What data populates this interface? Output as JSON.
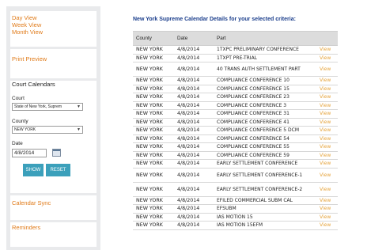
{
  "sidebar": {
    "views": [
      "Day View",
      "Week View",
      "Month View"
    ],
    "print_preview": "Print Preview",
    "court_calendars": {
      "title": "Court Calendars",
      "court_label": "Court",
      "court_value": "State of New York, Suprem",
      "county_label": "County",
      "county_value": "NEW YORK",
      "date_label": "Date",
      "date_value": "4/8/2014",
      "show_label": "SHOW",
      "reset_label": "RESET"
    },
    "calendar_sync": "Calendar Sync",
    "reminders": "Reminders"
  },
  "main": {
    "title": "New York Supreme Calendar Details for your selected criteria:",
    "columns": [
      "County",
      "Date",
      "Part",
      ""
    ],
    "rows": [
      {
        "county": "NEW YORK",
        "date": "4/8/2014",
        "part": "1TXPC PRELIMINARY CONFERENCE",
        "link": "View"
      },
      {
        "county": "NEW YORK",
        "date": "4/8/2014",
        "part": "1TXPT PRE-TRIAL",
        "link": "View"
      },
      {
        "county": "NEW YORK",
        "date": "4/8/2014",
        "part": "40 TRANS AUTH SETTLEMENT PART",
        "link": "View"
      },
      {
        "county": "NEW YORK",
        "date": "4/8/2014",
        "part": "COMPLIANCE CONFERENCE 10",
        "link": "View"
      },
      {
        "county": "NEW YORK",
        "date": "4/8/2014",
        "part": "COMPLIANCE CONFERENCE 15",
        "link": "View"
      },
      {
        "county": "NEW YORK",
        "date": "4/8/2014",
        "part": "COMPLIANCE CONFERENCE 23",
        "link": "View"
      },
      {
        "county": "NEW YORK",
        "date": "4/8/2014",
        "part": "COMPLIANCE CONFERENCE 3",
        "link": "View"
      },
      {
        "county": "NEW YORK",
        "date": "4/8/2014",
        "part": "COMPLIANCE CONFERENCE 31",
        "link": "View"
      },
      {
        "county": "NEW YORK",
        "date": "4/8/2014",
        "part": "COMPLIANCE CONFERENCE 41",
        "link": "View"
      },
      {
        "county": "NEW YORK",
        "date": "4/8/2014",
        "part": "COMPLIANCE CONFERENCE 5 DCM",
        "link": "View"
      },
      {
        "county": "NEW YORK",
        "date": "4/8/2014",
        "part": "COMPLIANCE CONFERENCE 54",
        "link": "View"
      },
      {
        "county": "NEW YORK",
        "date": "4/8/2014",
        "part": "COMPLIANCE CONFERENCE 55",
        "link": "View"
      },
      {
        "county": "NEW YORK",
        "date": "4/8/2014",
        "part": "COMPLIANCE CONFERENCE 59",
        "link": "View"
      },
      {
        "county": "NEW YORK",
        "date": "4/8/2014",
        "part": "EARLY SETTLEMENT CONFERENCE",
        "link": "View"
      },
      {
        "county": "NEW YORK",
        "date": "4/8/2014",
        "part": "EARLY SETTLEMENT CONFERENCE-1",
        "link": "View"
      },
      {
        "county": "NEW YORK",
        "date": "4/8/2014",
        "part": "EARLY SETTLEMENT CONFERENCE-2",
        "link": "View"
      },
      {
        "county": "NEW YORK",
        "date": "4/8/2014",
        "part": "EFILED COMMERCIAL SUBM CAL",
        "link": "View"
      },
      {
        "county": "NEW YORK",
        "date": "4/8/2014",
        "part": "EFSUBM",
        "link": "View"
      },
      {
        "county": "NEW YORK",
        "date": "4/8/2014",
        "part": "IAS MOTION 15",
        "link": "View"
      },
      {
        "county": "NEW YORK",
        "date": "4/8/2014",
        "part": "IAS MOTION 15EFM",
        "link": "View"
      }
    ]
  },
  "colors": {
    "link_orange": "#e07b1a",
    "view_link": "#e5a33b",
    "title_blue": "#1b3e8c",
    "button_teal": "#3ba0bb"
  }
}
